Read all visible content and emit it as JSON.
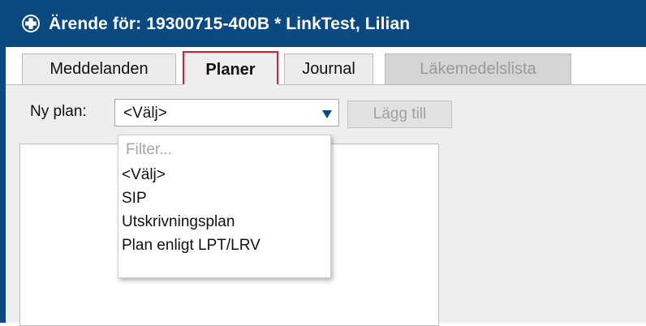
{
  "window": {
    "title": "Ärende för: 19300715-400B * LinkTest, Lilian",
    "frame_color": "#0b4a80"
  },
  "tabs": [
    {
      "label": "Meddelanden",
      "state": "normal"
    },
    {
      "label": "Planer",
      "state": "active"
    },
    {
      "label": "Journal",
      "state": "normal"
    },
    {
      "label": "Läkemedelslista",
      "state": "disabled"
    }
  ],
  "plan": {
    "label": "Ny plan:",
    "selected": "<Välj>",
    "add_button": "Lägg till",
    "filter_placeholder": "Filter...",
    "options": [
      "<Välj>",
      "SIP",
      "Utskrivningsplan",
      "Plan enligt LPT/LRV"
    ]
  },
  "highlight_color": "#e01e26"
}
